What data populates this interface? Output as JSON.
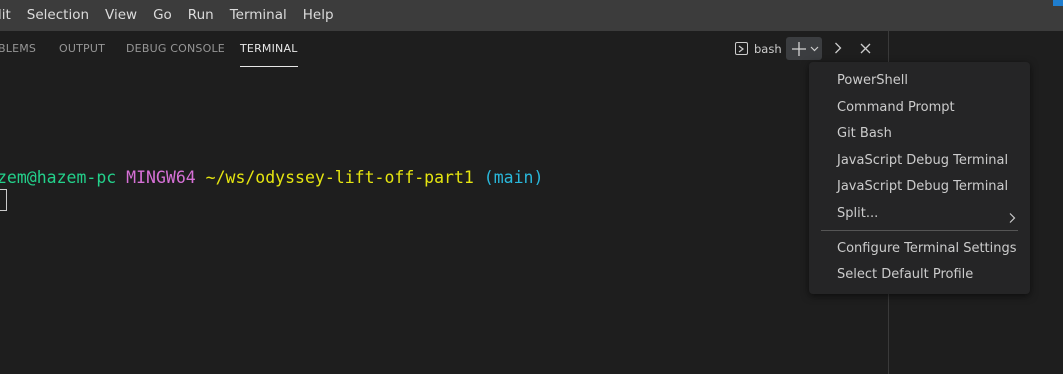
{
  "menubar": {
    "items": [
      "lit",
      "Selection",
      "View",
      "Go",
      "Run",
      "Terminal",
      "Help"
    ]
  },
  "panel": {
    "tabs": [
      "BLEMS",
      "OUTPUT",
      "DEBUG CONSOLE",
      "TERMINAL"
    ],
    "active_tab": "TERMINAL",
    "terminal_selector_label": "bash"
  },
  "terminal": {
    "user": "zem@hazem-pc",
    "system": "MINGW64",
    "path": "~/ws/odyssey-lift-off-part1",
    "branch": "(main)"
  },
  "dropdown": {
    "profiles": [
      "PowerShell",
      "Command Prompt",
      "Git Bash",
      "JavaScript Debug Terminal",
      "JavaScript Debug Terminal"
    ],
    "split_label": "Split...",
    "settings": [
      "Configure Terminal Settings",
      "Select Default Profile"
    ]
  },
  "colors": {
    "accent": "#1f7ecf",
    "prompt_user": "#23d18b",
    "prompt_system": "#d670d6",
    "prompt_path": "#e5e510",
    "prompt_branch": "#29b8db"
  },
  "icons": [
    "terminal-icon",
    "plus-icon",
    "chevron-down-icon",
    "chevron-right-icon",
    "close-icon",
    "submenu-arrow-icon"
  ]
}
